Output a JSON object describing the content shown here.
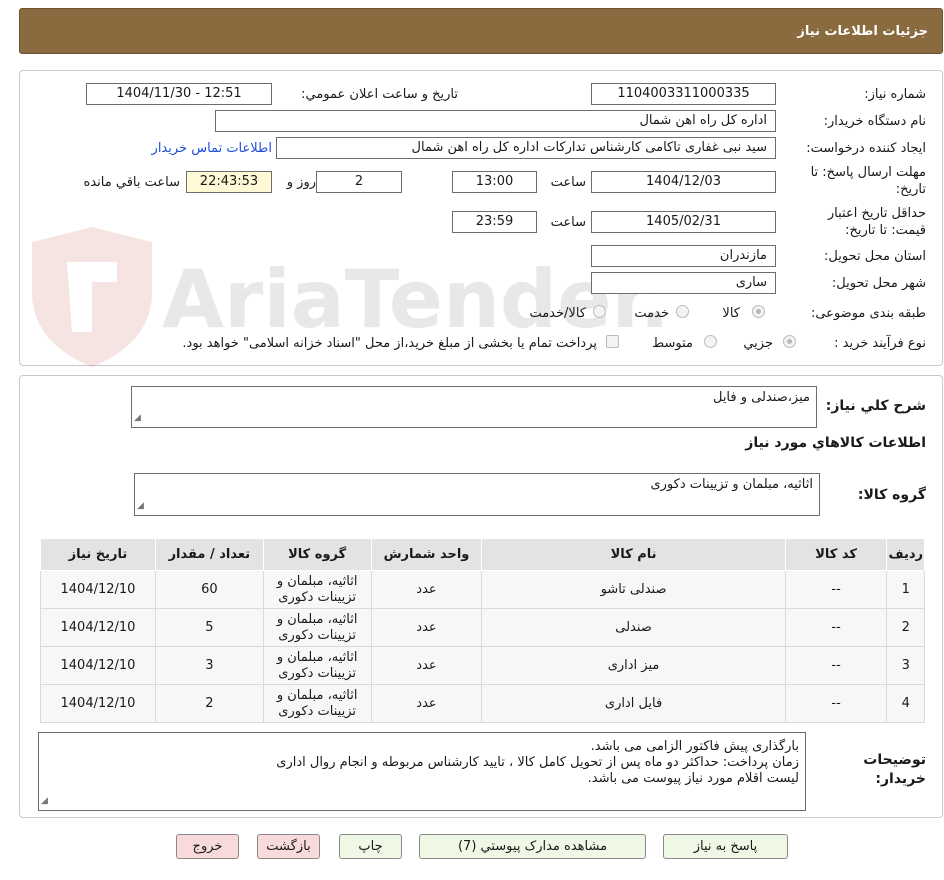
{
  "title": "جزئیات اطلاعات نیاز",
  "form": {
    "need_number_label": "شماره نیاز:",
    "need_number": "1104003311000335",
    "announce_label": "تاریخ و ساعت اعلان عمومي:",
    "announce_value": "1404/11/30 - 12:51",
    "buyer_org_label": "نام دستگاه خريدار:",
    "buyer_org": "اداره کل راه اهن شمال",
    "creator_label": "ايجاد کننده درخواست:",
    "creator": "سید نبی غفاری تاکامی کارشناس تدارکات اداره کل راه اهن شمال",
    "contact_link": "اطلاعات تماس خريدار",
    "reply_deadline_label": "مهلت ارسال پاسخ: تا تاريخ:",
    "reply_date": "1404/12/03",
    "time_label": "ساعت",
    "reply_time": "13:00",
    "days_value": "2",
    "days_label": "روز و",
    "remaining_time": "22:43:53",
    "remaining_label": "ساعت باقي مانده",
    "validity_label": "حداقل تاريخ اعتبار قيمت: تا تاريخ:",
    "validity_date": "1405/02/31",
    "validity_time": "23:59",
    "province_label": "استان محل تحويل:",
    "province": "مازندران",
    "city_label": "شهر محل تحويل:",
    "city": "ساری",
    "category_label": "طبقه بندی موضوعی:",
    "category_options": [
      "کالا",
      "خدمت",
      "کالا/خدمت"
    ],
    "process_label": "نوع فرآيند خريد :",
    "process_options": [
      "جزيي",
      "متوسط"
    ],
    "payment_note": "پرداخت تمام يا بخشی از مبلغ خريد،از محل \"اسناد خزانه اسلامی\" خواهد بود."
  },
  "summary": {
    "desc_label": "شرح کلي نياز:",
    "desc_value": "میز،صندلی و فایل",
    "goods_info_title": "اطلاعات کالاهاي مورد نياز",
    "group_label": "گروه کالا:",
    "group_value": "اثاثیه، مبلمان و تزیینات دکوری"
  },
  "table": {
    "headers": [
      "رديف",
      "کد کالا",
      "نام کالا",
      "واحد شمارش",
      "گروه کالا",
      "تعداد / مقدار",
      "تاريخ نياز"
    ],
    "rows": [
      {
        "row": "1",
        "code": "--",
        "name": "صندلی تاشو",
        "unit": "عدد",
        "group": "اثاثیه، مبلمان و تزیینات دکوری",
        "qty": "60",
        "date": "1404/12/10"
      },
      {
        "row": "2",
        "code": "--",
        "name": "صندلی",
        "unit": "عدد",
        "group": "اثاثیه، مبلمان و تزیینات دکوری",
        "qty": "5",
        "date": "1404/12/10"
      },
      {
        "row": "3",
        "code": "--",
        "name": "میز اداری",
        "unit": "عدد",
        "group": "اثاثیه، مبلمان و تزیینات دکوری",
        "qty": "3",
        "date": "1404/12/10"
      },
      {
        "row": "4",
        "code": "--",
        "name": "فایل اداری",
        "unit": "عدد",
        "group": "اثاثیه، مبلمان و تزیینات دکوری",
        "qty": "2",
        "date": "1404/12/10"
      }
    ]
  },
  "buyer_notes": {
    "label": "توضيحات خريدار:",
    "lines": [
      "بارگذاری پیش فاکتور الزامی می باشد.",
      "زمان پرداخت: حداکثر دو ماه پس از تحویل کامل کالا ، تایید کارشناس مربوطه و انجام روال اداری",
      "لیست اقلام مورد نیاز پیوست می باشد."
    ]
  },
  "buttons": {
    "reply": "پاسخ به نياز",
    "attachments": "مشاهده مدارک پيوستي (7)",
    "print": "چاپ",
    "back": "بازگشت",
    "exit": "خروج"
  },
  "watermark_text": "AriaTender.neT",
  "colors": {
    "header_bg": "#8a6a3f",
    "link": "#1f4ed8",
    "highlight": "#fff9d6"
  }
}
